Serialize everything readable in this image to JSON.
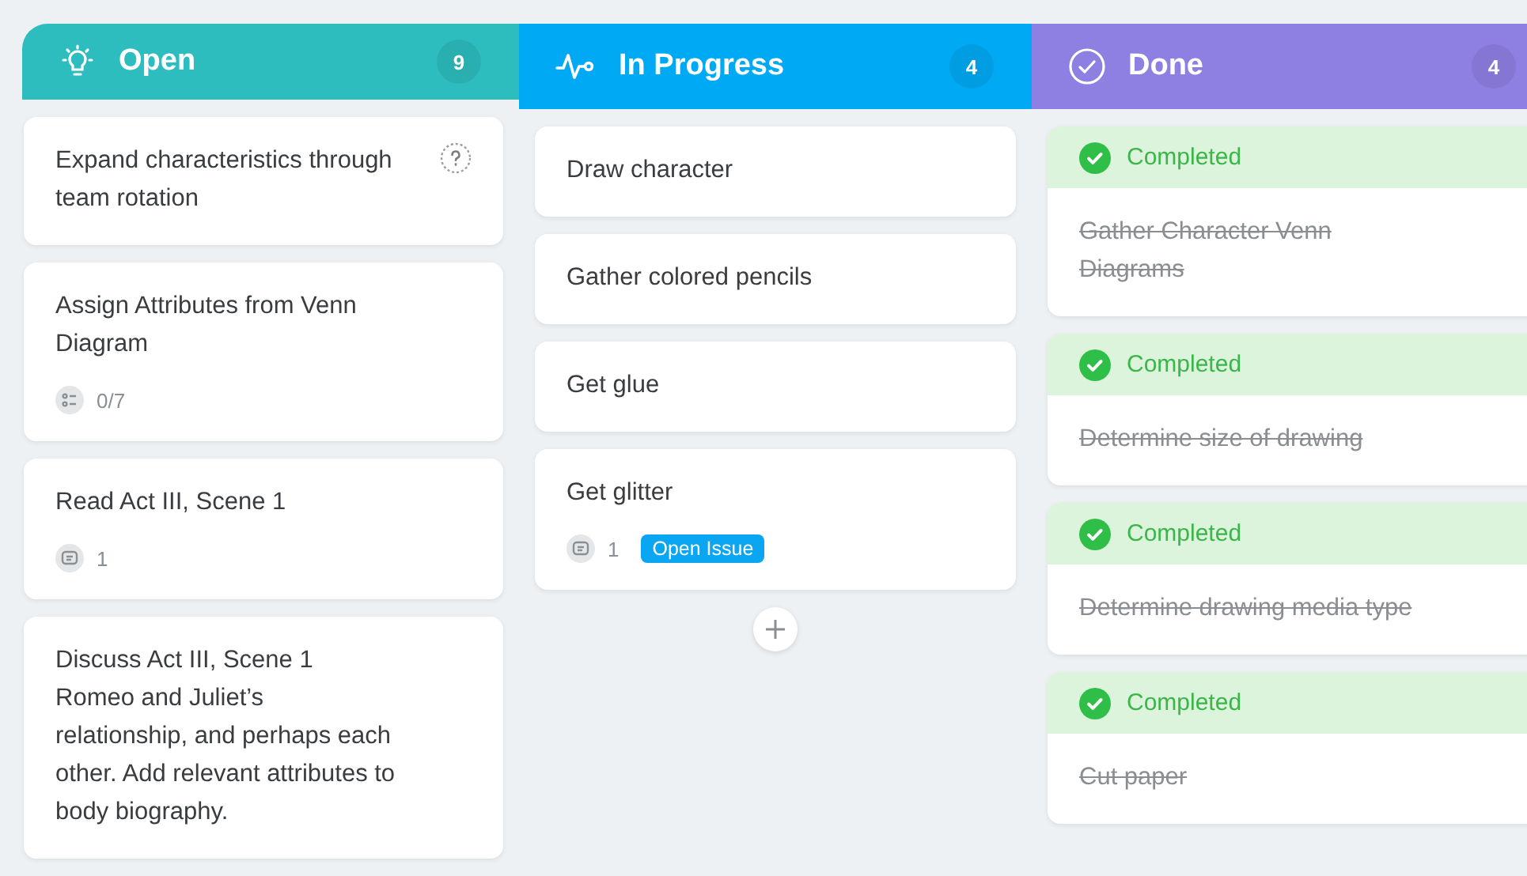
{
  "columns": [
    {
      "kind": "bulb",
      "title": "Open",
      "count": "9",
      "color": "#2ebdbf",
      "add_button": false,
      "cards": [
        {
          "title": "Expand characteristics through team rotation",
          "help": true
        },
        {
          "title": "Assign Attributes from Venn Diagram",
          "checklist": "0/7"
        },
        {
          "title": "Read Act III, Scene 1",
          "comments": "1"
        },
        {
          "title": "Discuss Act III, Scene 1 Romeo and Juliet’s relationship, and perhaps each other. Add relevant attributes to body biography."
        }
      ]
    },
    {
      "kind": "pulse",
      "title": "In Progress",
      "count": "4",
      "color": "#00a9f4",
      "add_button": true,
      "cards": [
        {
          "title": "Draw character"
        },
        {
          "title": "Gather colored pencils"
        },
        {
          "title": "Get glue"
        },
        {
          "title": "Get glitter",
          "comments": "1",
          "tag": "Open Issue"
        }
      ]
    },
    {
      "kind": "check",
      "title": "Done",
      "count": "4",
      "color": "#8e7fe2",
      "add_button": false,
      "cards": [
        {
          "title": "Gather Character Venn Diagrams",
          "completed": true,
          "status": "Completed"
        },
        {
          "title": "Determine size of drawing",
          "completed": true,
          "status": "Completed"
        },
        {
          "title": "Determine drawing media type",
          "completed": true,
          "status": "Completed"
        },
        {
          "title": "Cut paper",
          "completed": true,
          "status": "Completed"
        }
      ]
    }
  ]
}
